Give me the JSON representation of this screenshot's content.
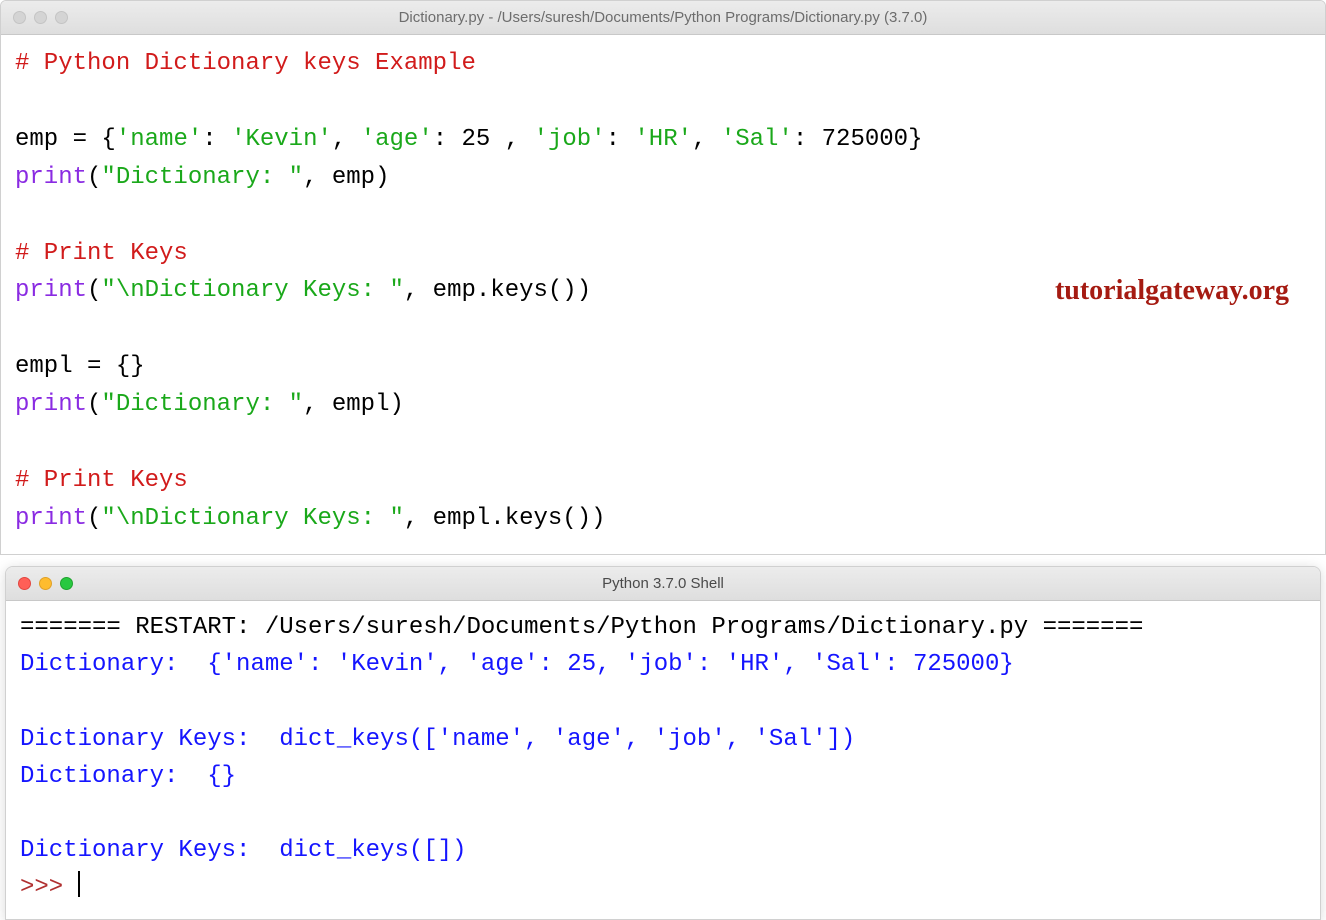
{
  "editor": {
    "title": "Dictionary.py - /Users/suresh/Documents/Python Programs/Dictionary.py (3.7.0)",
    "code": {
      "l1_comment": "# Python Dictionary keys Example",
      "l3_var": "emp = {",
      "l3_k1": "'name'",
      "l3_v1": "'Kevin'",
      "l3_k2": "'age'",
      "l3_v2": "25",
      "l3_k3": "'job'",
      "l3_v3": "'HR'",
      "l3_k4": "'Sal'",
      "l3_v4": "725000",
      "l3_end": "}",
      "l4_print": "print",
      "l4_str": "\"Dictionary: \"",
      "l4_arg": ", emp)",
      "l6_comment": "# Print Keys",
      "l7_str": "\"\\nDictionary Keys: \"",
      "l7_arg": ", emp.keys())",
      "l9_var": "empl = {}",
      "l10_str": "\"Dictionary: \"",
      "l10_arg": ", empl)",
      "l12_comment": "# Print Keys",
      "l13_str": "\"\\nDictionary Keys: \"",
      "l13_arg": ", empl.keys())"
    },
    "watermark": "tutorialgateway.org"
  },
  "shell": {
    "title": "Python 3.7.0 Shell",
    "restart_prefix": "======= ",
    "restart_label": "RESTART: /Users/suresh/Documents/Python Programs/Dictionary.py",
    "restart_suffix": " =======",
    "out1": "Dictionary:  {'name': 'Kevin', 'age': 25, 'job': 'HR', 'Sal': 725000}",
    "out2": "Dictionary Keys:  dict_keys(['name', 'age', 'job', 'Sal'])",
    "out3": "Dictionary:  {}",
    "out4": "Dictionary Keys:  dict_keys([])",
    "prompt": ">>> "
  }
}
